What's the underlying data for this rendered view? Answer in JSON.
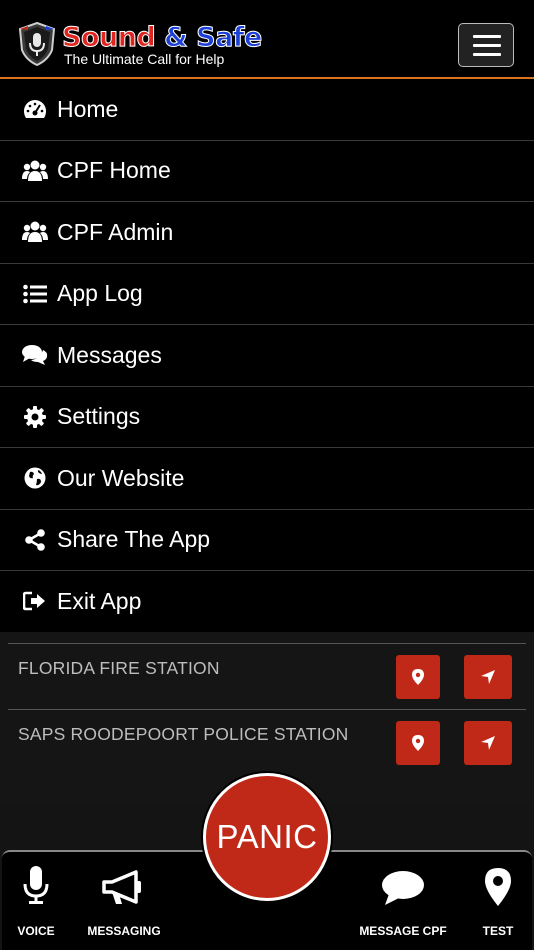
{
  "header": {
    "brand_word1": "Sound",
    "brand_amp": "&",
    "brand_word2": "Safe",
    "tagline": "The Ultimate Call for Help",
    "menu_icon": "hamburger-icon"
  },
  "menu": {
    "items": [
      {
        "label": "Home",
        "icon": "dashboard-icon"
      },
      {
        "label": "CPF Home",
        "icon": "users-icon"
      },
      {
        "label": "CPF Admin",
        "icon": "users-icon"
      },
      {
        "label": "App Log",
        "icon": "list-icon"
      },
      {
        "label": "Messages",
        "icon": "comments-icon"
      },
      {
        "label": "Settings",
        "icon": "gear-icon"
      },
      {
        "label": "Our Website",
        "icon": "globe-icon"
      },
      {
        "label": "Share The App",
        "icon": "share-icon"
      },
      {
        "label": "Exit App",
        "icon": "sign-out-icon"
      }
    ]
  },
  "stations": [
    {
      "name": "FLORIDA FIRE STATION"
    },
    {
      "name": "SAPS ROODEPOORT POLICE STATION"
    }
  ],
  "bottom_nav": {
    "voice": "VOICE",
    "messaging": "MESSAGING",
    "message_cpf": "MESSAGE CPF",
    "test": "TEST"
  },
  "panic": "PANIC",
  "colors": {
    "accent_red": "#c02818",
    "header_border": "#d9741f",
    "brand_red": "#e0241f",
    "brand_blue": "#1c3fd6"
  }
}
